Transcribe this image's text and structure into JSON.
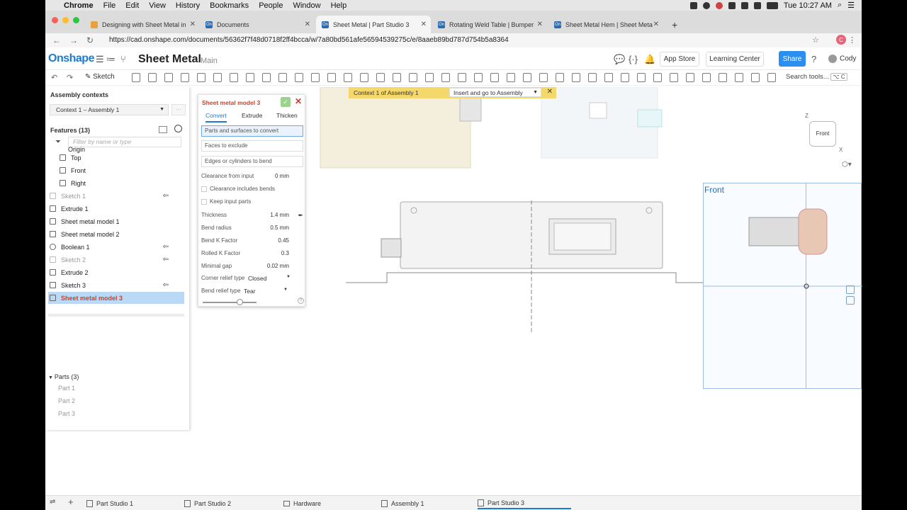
{
  "menubar": {
    "app": "Chrome",
    "items": [
      "File",
      "Edit",
      "View",
      "History",
      "Bookmarks",
      "People",
      "Window",
      "Help"
    ],
    "clock": "Tue 10:27 AM"
  },
  "browser": {
    "tabs": [
      {
        "label": "Designing with Sheet Metal in"
      },
      {
        "label": "Documents"
      },
      {
        "label": "Sheet Metal | Part Studio 3"
      },
      {
        "label": "Rotating Weld Table | Bumper"
      },
      {
        "label": "Sheet Metal Hem | Sheet Meta"
      }
    ],
    "url": "https://cad.onshape.com/documents/56362f7f48d0718f2ff4bcca/w/7a80bd561afe56594539275c/e/8aaeb89bd787d754b5a8364",
    "profile_initial": "C"
  },
  "header": {
    "logo": "Onshape",
    "doc_title": "Sheet Metal",
    "branch": "Main",
    "app_store": "App Store",
    "learning_center": "Learning Center",
    "share": "Share",
    "user": "Cody"
  },
  "toolbar": {
    "sketch": "Sketch",
    "search": "Search tools...",
    "search_shortcut": "⌥ C"
  },
  "left": {
    "assembly_contexts": "Assembly contexts",
    "context_value": "Context 1 – Assembly 1",
    "features_title": "Features (13)",
    "filter_placeholder": "Filter by name or type",
    "features": [
      {
        "label": "Origin"
      },
      {
        "label": "Top"
      },
      {
        "label": "Front"
      },
      {
        "label": "Right"
      },
      {
        "label": "Sketch 1"
      },
      {
        "label": "Extrude 1"
      },
      {
        "label": "Sheet metal model 1"
      },
      {
        "label": "Sheet metal model 2"
      },
      {
        "label": "Boolean 1"
      },
      {
        "label": "Sketch 2"
      },
      {
        "label": "Extrude 2"
      },
      {
        "label": "Sketch 3"
      },
      {
        "label": "Sheet metal model 3"
      }
    ],
    "parts_title": "Parts (3)",
    "parts": [
      "Part 1",
      "Part 2",
      "Part 3"
    ]
  },
  "feature_dialog": {
    "title": "Sheet metal model 3",
    "tabs": [
      "Convert",
      "Extrude",
      "Thicken"
    ],
    "parts_field": "Parts and surfaces to convert",
    "faces_field": "Faces to exclude",
    "edges_field": "Edges or cylinders to bend",
    "clearance_label": "Clearance from input",
    "clearance_value": "0 mm",
    "clearance_bends": "Clearance includes bends",
    "keep_input": "Keep input parts",
    "thickness_label": "Thickness",
    "thickness_value": "1.4 mm",
    "bend_radius_label": "Bend radius",
    "bend_radius_value": "0.5 mm",
    "bend_k_label": "Bend K Factor",
    "bend_k_value": "0.45",
    "rolled_k_label": "Rolled K Factor",
    "rolled_k_value": "0.3",
    "min_gap_label": "Minimal gap",
    "min_gap_value": "0.02 mm",
    "corner_relief_label": "Corner relief type",
    "corner_relief_value": "Closed",
    "bend_relief_label": "Bend relief type",
    "bend_relief_value": "Tear"
  },
  "banner": {
    "text": "Context 1 of Assembly 1",
    "button": "Insert and go to Assembly"
  },
  "viewcube": {
    "face": "Front",
    "z": "Z",
    "x": "X"
  },
  "front_view_label": "Front",
  "bottom_tabs": [
    "Part Studio 1",
    "Part Studio 2",
    "Hardware",
    "Assembly 1",
    "Part Studio 3"
  ]
}
